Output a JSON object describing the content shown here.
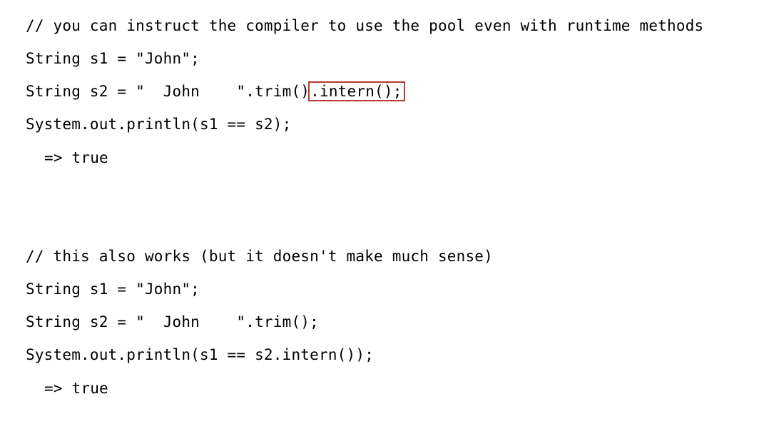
{
  "block1": {
    "comment": "// you can instruct the compiler to use the pool even with runtime methods",
    "line1": "String s1 = \"John\";",
    "line2_prefix": "String s2 = \"  John    \".trim()",
    "line2_highlight": ".intern();",
    "line3": "System.out.println(s1 == s2);",
    "result": "=> true"
  },
  "block2": {
    "comment": "// this also works (but it doesn't make much sense)",
    "line1": "String s1 = \"John\";",
    "line2": "String s2 = \"  John    \".trim();",
    "line3": "System.out.println(s1 == s2.intern());",
    "result": "=> true"
  },
  "colors": {
    "highlight_box": "#b73a32",
    "text": "#000000",
    "background": "#ffffff"
  }
}
